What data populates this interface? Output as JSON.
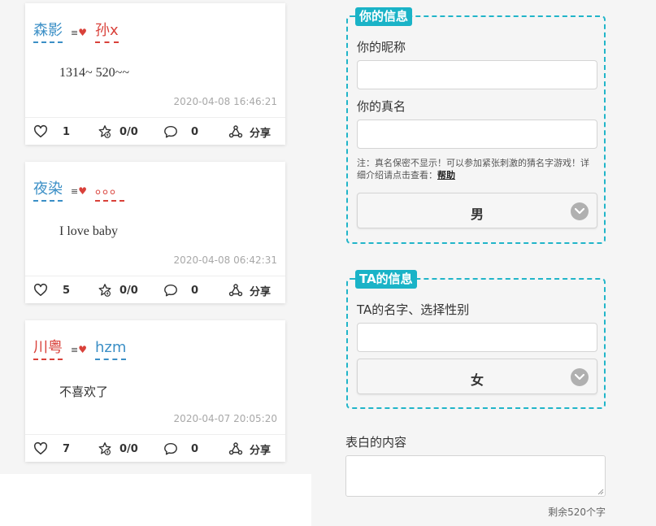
{
  "posts": [
    {
      "from_name": "森影",
      "from_color": "blue",
      "to_name": "孙x",
      "to_color": "red",
      "message": "1314~ 520~~",
      "time": "2020-04-08 16:46:21",
      "likes": "1",
      "gifts": "0/0",
      "comments": "0",
      "share_label": "分享"
    },
    {
      "from_name": "夜染",
      "from_color": "blue",
      "to_name": "。。。",
      "to_color": "red",
      "message": "I love baby",
      "time": "2020-04-08 06:42:31",
      "likes": "5",
      "gifts": "0/0",
      "comments": "0",
      "share_label": "分享"
    },
    {
      "from_name": "川粤",
      "from_color": "red",
      "to_name": "hzm",
      "to_color": "blue",
      "message": "不喜欢了",
      "time": "2020-04-07 20:05:20",
      "likes": "7",
      "gifts": "0/0",
      "comments": "0",
      "share_label": "分享"
    }
  ],
  "your_info": {
    "legend": "你的信息",
    "nickname_label": "你的昵称",
    "nickname_value": "",
    "realname_label": "你的真名",
    "realname_value": "",
    "note": "注：真名保密不显示！可以参加紧张刺激的猜名字游戏！详细介绍请点击查看：",
    "help_link": "帮助",
    "gender_selected": "男"
  },
  "ta_info": {
    "legend": "TA的信息",
    "name_label": "TA的名字、选择性别",
    "name_value": "",
    "gender_selected": "女"
  },
  "confession": {
    "label": "表白的内容",
    "value": "",
    "remaining": "剩余520个字"
  },
  "colors": {
    "accent": "#1ab3c7",
    "name_blue": "#3b8fc6",
    "name_red": "#d9413a"
  },
  "icons": [
    "heart-icon",
    "gift-icon",
    "comment-icon",
    "share-icon",
    "chevron-down-icon"
  ]
}
